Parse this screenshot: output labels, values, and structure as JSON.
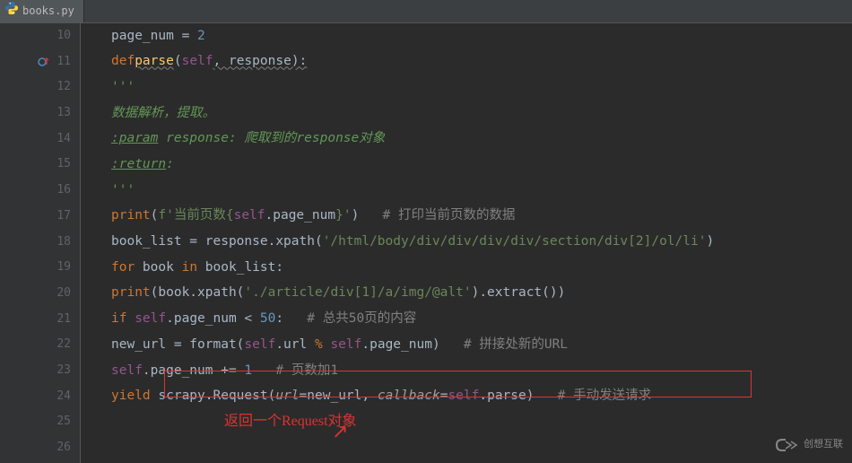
{
  "tab": {
    "filename": "books.py"
  },
  "gutter": {
    "start": 10,
    "end": 26
  },
  "code": {
    "l10_a": "page_num = ",
    "l10_b": "2",
    "l11_a": "def",
    "l11_b": "parse",
    "l11_c": "(",
    "l11_d": "self",
    "l11_e": ", response):",
    "l12": "'''",
    "l13": "数据解析，提取。",
    "l14_a": ":param",
    "l14_b": " response: 爬取到的response对象",
    "l15_a": ":return",
    "l15_b": ":",
    "l16": "'''",
    "l17_a": "print",
    "l17_b": "(",
    "l17_c": "f'当前页数{",
    "l17_d": "self",
    "l17_e": ".page_num",
    "l17_f": "}'",
    "l17_g": ")   ",
    "l17_h": "# 打印当前页数的数据",
    "l18_a": "book_list = response.xpath(",
    "l18_b": "'/html/body/div/div/div/div/section/div[2]/ol/li'",
    "l18_c": ")",
    "l19_a": "for",
    "l19_b": " book ",
    "l19_c": "in",
    "l19_d": " book_list:",
    "l20_a": "print",
    "l20_b": "(book.xpath(",
    "l20_c": "'./article/div[1]/a/img/@alt'",
    "l20_d": ").extract())",
    "l21_a": "if",
    "l21_b": " ",
    "l21_c": "self",
    "l21_d": ".page_num < ",
    "l21_e": "50",
    "l21_f": ":   ",
    "l21_g": "# 总共50页的内容",
    "l22_a": "new_url = format(",
    "l22_b": "self",
    "l22_c": ".url ",
    "l22_d": "%",
    "l22_e": " ",
    "l22_f": "self",
    "l22_g": ".page_num)   ",
    "l22_h": "# 拼接处新的URL",
    "l23_a": "self",
    "l23_b": ".page_num += ",
    "l23_c": "1",
    "l23_d": "   ",
    "l23_e": "# 页数加1",
    "l24_a": "yield",
    "l24_b": " scrapy.Request(",
    "l24_c": "url",
    "l24_d": "=new_url, ",
    "l24_e": "callback",
    "l24_f": "=",
    "l24_g": "self",
    "l24_h": ".parse)   ",
    "l24_i": "# 手动发送请求"
  },
  "annotation": "返回一个Request对象",
  "watermark": "创想互联"
}
